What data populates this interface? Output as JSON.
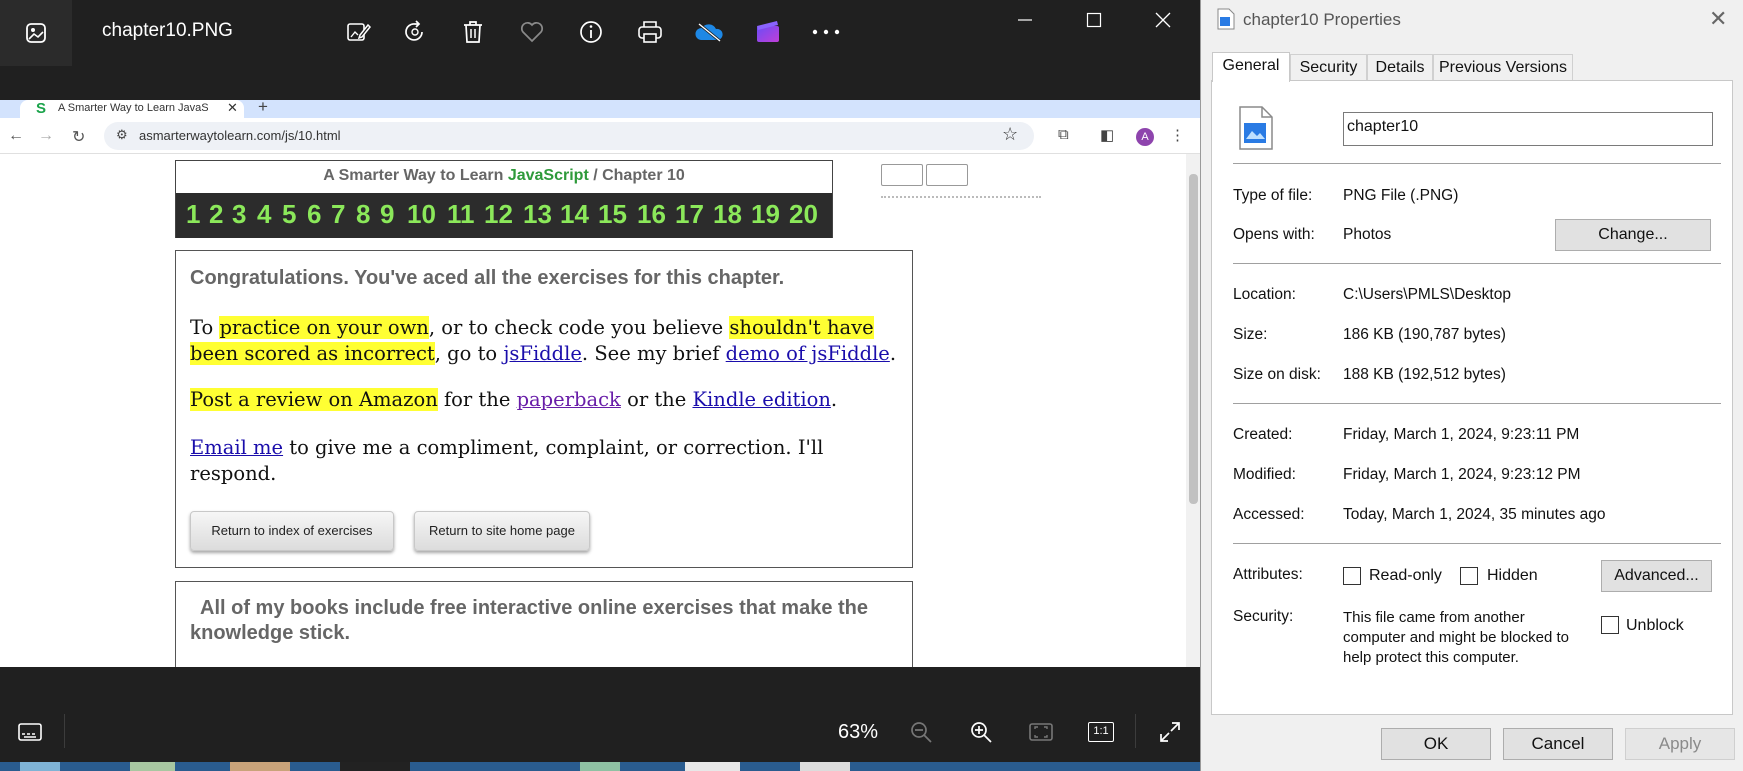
{
  "viewer": {
    "file_name": "chapter10.PNG",
    "zoom": "63%",
    "toolbar_icons": [
      "edit-image-icon",
      "rotate-icon",
      "delete-icon",
      "favorite-icon",
      "info-icon",
      "print-icon",
      "onedrive-icon",
      "clipchamp-icon",
      "more-icon"
    ],
    "bottom_icons": [
      "filmstrip-icon",
      "zoom-out-icon",
      "zoom-in-icon",
      "fit-icon",
      "actual-size-icon",
      "fullscreen-icon"
    ],
    "actual_size_label": "1:1"
  },
  "browser": {
    "tab_title": "A Smarter Way to Learn JavaScript",
    "url": "asmarterwaytolearn.com/js/10.html",
    "avatar_letter": "A"
  },
  "webpage": {
    "header_prefix": "A Smarter Way to Learn ",
    "header_js": "JavaScript",
    "header_suffix": "  /  Chapter 10",
    "chapter_numbers": [
      "1",
      "2",
      "3",
      "4",
      "5",
      "6",
      "7",
      "8",
      "9",
      "10",
      "11",
      "12",
      "13",
      "14",
      "15",
      "16",
      "17",
      "18",
      "19",
      "20"
    ],
    "congrats": "Congratulations. You've aced all the exercises for this chapter.",
    "p1": {
      "t1": "To ",
      "hl1": "practice on your own",
      "t2": ", or to check code you believe ",
      "hl2": "shouldn't have been scored as incorrect",
      "t3": ", go to ",
      "link1": "jsFiddle",
      "t4": ". See my brief ",
      "link2": "demo of jsFiddle",
      "t5": "."
    },
    "p2": {
      "hl": "Post a review on Amazon",
      "t1": " for the ",
      "link1": "paperback",
      "t2": " or the ",
      "link2": "Kindle edition",
      "t3": "."
    },
    "p3": {
      "link": "Email me",
      "t1": " to give me a compliment, complaint, or correction. I'll respond."
    },
    "btn_index": "Return to index of exercises",
    "btn_home": "Return to site home page",
    "books_text": "All of my books include free interactive online exercises that make the knowledge stick."
  },
  "dialog": {
    "title": "chapter10 Properties",
    "tabs": [
      "General",
      "Security",
      "Details",
      "Previous Versions"
    ],
    "name_value": "chapter10",
    "rows": {
      "type_label": "Type of file:",
      "type_value": "PNG File (.PNG)",
      "opens_label": "Opens with:",
      "opens_value": "Photos",
      "change_btn": "Change...",
      "location_label": "Location:",
      "location_value": "C:\\Users\\PMLS\\Desktop",
      "size_label": "Size:",
      "size_value": "186 KB (190,787 bytes)",
      "disk_label": "Size on disk:",
      "disk_value": "188 KB (192,512 bytes)",
      "created_label": "Created:",
      "created_value": "Friday, March 1, 2024, 9:23:11 PM",
      "modified_label": "Modified:",
      "modified_value": "Friday, March 1, 2024, 9:23:12 PM",
      "accessed_label": "Accessed:",
      "accessed_value": "Today, March 1, 2024, 35 minutes ago",
      "attributes_label": "Attributes:",
      "readonly_label": "Read-only",
      "hidden_label": "Hidden",
      "advanced_btn": "Advanced...",
      "security_label": "Security:",
      "security_text": "This file came from another computer and might be blocked to help protect this computer.",
      "unblock_label": "Unblock"
    },
    "ok": "OK",
    "cancel": "Cancel",
    "apply": "Apply"
  }
}
